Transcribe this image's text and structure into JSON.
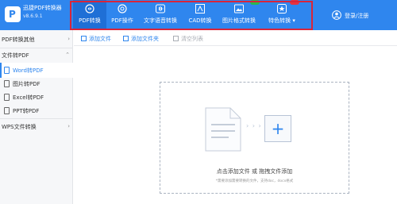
{
  "app": {
    "name": "迅捷PDF转换器",
    "version": "v8.6.9.1"
  },
  "nav": {
    "items": [
      {
        "label": "PDF转换",
        "icon": "convert-icon",
        "active": true
      },
      {
        "label": "PDF操作",
        "icon": "search-doc-icon",
        "active": false
      },
      {
        "label": "文字语音转换",
        "icon": "audio-wave-icon",
        "active": false
      },
      {
        "label": "CAD转换",
        "icon": "cad-icon",
        "active": false
      },
      {
        "label": "图片格式转换",
        "icon": "image-icon",
        "active": false
      },
      {
        "label": "特色转换",
        "icon": "star-box-icon",
        "active": false,
        "dropdown": "▾"
      }
    ]
  },
  "user": {
    "label": "登录/注册",
    "icon": "user-icon"
  },
  "sidebar": {
    "groups": [
      {
        "label": "PDF转换其他",
        "chevron": "›"
      },
      {
        "label": "文件转PDF",
        "chevron": "⌃"
      },
      {
        "label": "WPS文件转换",
        "chevron": "›"
      }
    ],
    "items": [
      {
        "label": "Word转PDF",
        "active": true
      },
      {
        "label": "图片转PDF",
        "active": false
      },
      {
        "label": "Excel转PDF",
        "active": false
      },
      {
        "label": "PPT转PDF",
        "active": false
      }
    ]
  },
  "toolbar": {
    "add_file": "添加文件",
    "add_folder": "添加文件夹",
    "clear_list": "清空列表"
  },
  "dropzone": {
    "title": "点击添加文件 或 拖拽文件添加",
    "hint": "*需要添加需要转换的文件，支持doc，docx格式",
    "arrows": "› › ›",
    "plus": "+"
  },
  "colors": {
    "primary": "#2f86ee",
    "header_active": "#1f6fd6",
    "highlight_outline": "#d8253a",
    "badge_green": "#2db84d",
    "badge_red": "#e8333f"
  }
}
